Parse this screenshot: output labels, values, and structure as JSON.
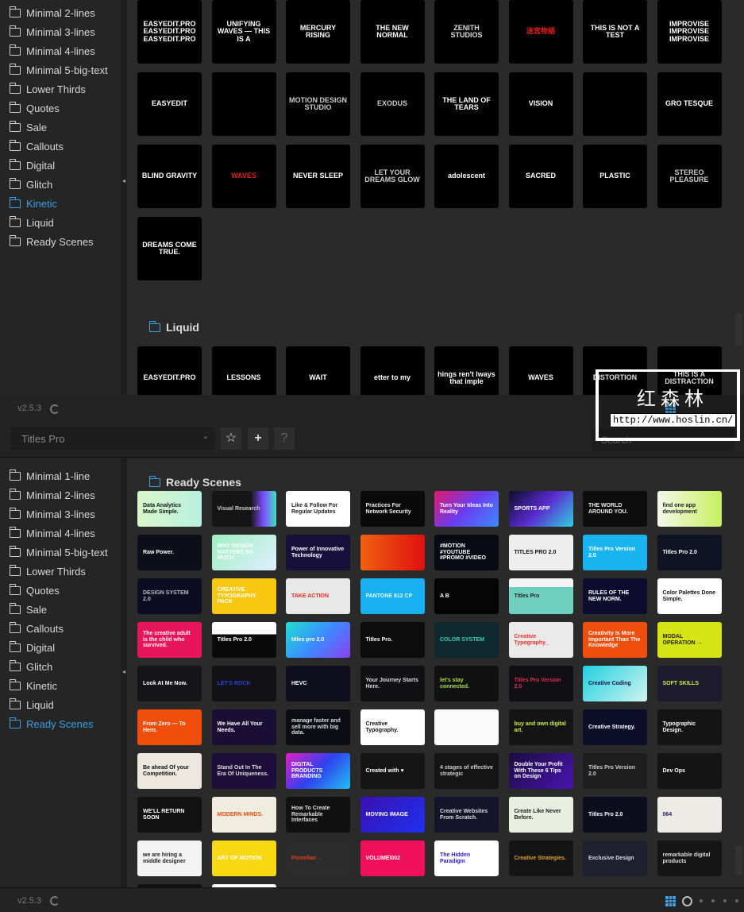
{
  "top_panel": {
    "sidebar": [
      {
        "label": "Minimal 2-lines"
      },
      {
        "label": "Minimal 3-lines"
      },
      {
        "label": "Minimal 4-lines"
      },
      {
        "label": "Minimal 5-big-text"
      },
      {
        "label": "Lower Thirds"
      },
      {
        "label": "Quotes"
      },
      {
        "label": "Sale"
      },
      {
        "label": "Callouts"
      },
      {
        "label": "Digital"
      },
      {
        "label": "Glitch"
      },
      {
        "label": "Kinetic",
        "active": true
      },
      {
        "label": "Liquid"
      },
      {
        "label": "Ready Scenes"
      }
    ],
    "kinetic_thumbs": [
      {
        "t": "EASYEDIT.PRO EASYEDIT.PRO EASYEDIT.PRO",
        "bg": "#000",
        "fg": "#fff"
      },
      {
        "t": "UNIFYING WAVES — THIS IS A",
        "bg": "#000",
        "fg": "#fff"
      },
      {
        "t": "MERCURY RISING",
        "bg": "#000",
        "fg": "#fff"
      },
      {
        "t": "THE NEW NORMAL",
        "bg": "#000",
        "fg": "#fff"
      },
      {
        "t": "ZENITH STUDIOS",
        "bg": "#000",
        "fg": "#ddd"
      },
      {
        "t": "迷宫物語",
        "bg": "#000",
        "fg": "#e0201c"
      },
      {
        "t": "THIS IS NOT A TEST",
        "bg": "#000",
        "fg": "#fff"
      },
      {
        "t": "IMPROVISE IMPROVISE IMPROVISE",
        "bg": "#000",
        "fg": "#fff"
      },
      {
        "t": "EASYEDIT",
        "bg": "#000",
        "fg": "#fff"
      },
      {
        "t": "",
        "bg": "#000",
        "fg": "#c00"
      },
      {
        "t": "MOTION DESIGN STUDIO",
        "bg": "#000",
        "fg": "#ccc"
      },
      {
        "t": "EXODUS",
        "bg": "#000",
        "fg": "#ccc"
      },
      {
        "t": "THE LAND OF TEARS",
        "bg": "#000",
        "fg": "#fff"
      },
      {
        "t": "VISION",
        "bg": "#000",
        "fg": "#fff"
      },
      {
        "t": "",
        "bg": "#000",
        "fg": "#e0201c"
      },
      {
        "t": "GRO TESQUE",
        "bg": "#000",
        "fg": "#fff"
      },
      {
        "t": "BLIND GRAVITY",
        "bg": "#000",
        "fg": "#fff"
      },
      {
        "t": "WAVES",
        "bg": "#000",
        "fg": "#e0201c"
      },
      {
        "t": "NEVER SLEEP",
        "bg": "#000",
        "fg": "#fff"
      },
      {
        "t": "LET YOUR DREAMS GLOW",
        "bg": "#000",
        "fg": "#ccc"
      },
      {
        "t": "adolescent",
        "bg": "#000",
        "fg": "#fff"
      },
      {
        "t": "SACRED",
        "bg": "#000",
        "fg": "#fff"
      },
      {
        "t": "PLASTIC",
        "bg": "#000",
        "fg": "#fff"
      },
      {
        "t": "STEREO PLEASURE",
        "bg": "#000",
        "fg": "#ccc"
      },
      {
        "t": "DREAMS COME TRUE.",
        "bg": "#000",
        "fg": "#fff"
      }
    ],
    "liquid_heading": "Liquid",
    "liquid_thumbs": [
      {
        "t": "EASYEDIT.PRO",
        "bg": "#000",
        "fg": "#fff"
      },
      {
        "t": "LESSONS",
        "bg": "#000",
        "fg": "#fff"
      },
      {
        "t": "WAIT",
        "bg": "#000",
        "fg": "#fff"
      },
      {
        "t": "etter to my",
        "bg": "#000",
        "fg": "#fff"
      },
      {
        "t": "hings ren't lways that imple",
        "bg": "#000",
        "fg": "#fff"
      },
      {
        "t": "WAVES",
        "bg": "#000",
        "fg": "#fff"
      },
      {
        "t": "DISTORTION",
        "bg": "#000",
        "fg": "#fff"
      },
      {
        "t": "THIS IS A DISTRACTION",
        "bg": "#000",
        "fg": "#fff"
      }
    ]
  },
  "footer_top": {
    "version": "v2.5.3"
  },
  "toolbar": {
    "preset": "Titles Pro",
    "star": "☆",
    "plus": "+",
    "help": "?",
    "search_placeholder": "Search"
  },
  "bottom_panel": {
    "sidebar": [
      {
        "label": "Minimal 1-line"
      },
      {
        "label": "Minimal 2-lines"
      },
      {
        "label": "Minimal 3-lines"
      },
      {
        "label": "Minimal 4-lines"
      },
      {
        "label": "Minimal 5-big-text"
      },
      {
        "label": "Lower Thirds"
      },
      {
        "label": "Quotes"
      },
      {
        "label": "Sale"
      },
      {
        "label": "Callouts"
      },
      {
        "label": "Digital"
      },
      {
        "label": "Glitch"
      },
      {
        "label": "Kinetic"
      },
      {
        "label": "Liquid"
      },
      {
        "label": "Ready Scenes",
        "active": true
      }
    ],
    "heading": "Ready Scenes",
    "thumbs": [
      {
        "t": "Data Analytics Made Simple.",
        "bg": "linear-gradient(90deg,#d9f7c8,#b8f0e0)",
        "fg": "#111"
      },
      {
        "t": "Visual Research",
        "bg": "linear-gradient(90deg,#151515 60%,#7a4cff,#46e0c0)",
        "fg": "#ccc"
      },
      {
        "t": "Like & Follow For Regular Updates",
        "bg": "#fff",
        "fg": "#222"
      },
      {
        "t": "Practices For Network Security",
        "bg": "#0a0a0a",
        "fg": "#eee"
      },
      {
        "t": "Turn Your Ideas Into Reality",
        "bg": "linear-gradient(135deg,#e4186b,#6a3cf0,#3b8cff)",
        "fg": "#fff"
      },
      {
        "t": "SPORTS APP",
        "bg": "linear-gradient(135deg,#0c0c2a,#5a2bd0,#30d0e0)",
        "fg": "#fff"
      },
      {
        "t": "THE WORLD AROUND YOU.",
        "bg": "#0d0d0d",
        "fg": "#eee"
      },
      {
        "t": "find one app development",
        "bg": "linear-gradient(90deg,#f4f8e8,#c8f060)",
        "fg": "#222"
      },
      {
        "t": "Raw Power.",
        "bg": "#0e0e1a",
        "fg": "#fff"
      },
      {
        "t": "WHY DESIGN MATTERS SO MUCH",
        "bg": "linear-gradient(135deg,#9ef0c0,#dfefff)",
        "fg": "#fff"
      },
      {
        "t": "Power of Innovative Technology",
        "bg": "#16103a",
        "fg": "#fff"
      },
      {
        "t": "",
        "bg": "linear-gradient(90deg,#f06010,#e01010)",
        "fg": "#fff"
      },
      {
        "t": "#MOTION #YOUTUBE #PROMO #VIDEO",
        "bg": "#0a0a14",
        "fg": "#fff"
      },
      {
        "t": "TITLES PRO 2.0",
        "bg": "#eeeeee",
        "fg": "#111"
      },
      {
        "t": "Titles Pro Version 2.0",
        "bg": "#18b4f0",
        "fg": "#fff"
      },
      {
        "t": "Titles Pro 2.0",
        "bg": "#0f1424",
        "fg": "#fff"
      },
      {
        "t": "DESIGN SYSTEM 2.0",
        "bg": "#0e0c22",
        "fg": "#bbb"
      },
      {
        "t": "CREATIVE TYPOGRAPHY PACK",
        "bg": "#f8c810",
        "fg": "#fff"
      },
      {
        "t": "TAKE ACTION",
        "bg": "#e8e8e8",
        "fg": "#e0301c"
      },
      {
        "t": "PANTONE 812 CP",
        "bg": "#18b0f0",
        "fg": "#dff"
      },
      {
        "t": "A B",
        "bg": "#050505",
        "fg": "#fff"
      },
      {
        "t": "Titles Pro",
        "bg": "linear-gradient(180deg,#f4f4f4 25%,#70d0c0 25%)",
        "fg": "#222"
      },
      {
        "t": "RULES OF THE NEW NORM.",
        "bg": "#0e0c2e",
        "fg": "#fff"
      },
      {
        "t": "Color Palettes Done Simple.",
        "bg": "#fff",
        "fg": "#111"
      },
      {
        "t": "The creative adult is the child who survived.",
        "bg": "#e8145c",
        "fg": "#fff"
      },
      {
        "t": "Titles Pro 2.0",
        "bg": "linear-gradient(180deg,#fff 35%,#0a0a0a 35%)",
        "fg": "#fff"
      },
      {
        "t": "titles pro 2.0",
        "bg": "linear-gradient(135deg,#20e0d0,#3a8cff,#8a40f0)",
        "fg": "#fff"
      },
      {
        "t": "Titles Pro.",
        "bg": "#0c0c0c",
        "fg": "#fff"
      },
      {
        "t": "COLOR SYSTEM",
        "bg": "#0f2a2e",
        "fg": "#3fd0b0"
      },
      {
        "t": "Creative Typography_",
        "bg": "#eaeaea",
        "fg": "#e8302c"
      },
      {
        "t": "Creativity Is More Important Than The Knowledge",
        "bg": "#f04e0c",
        "fg": "#fff"
      },
      {
        "t": "MODAL OPERATION →",
        "bg": "#d6e414",
        "fg": "#222"
      },
      {
        "t": "Look At Me Now.",
        "bg": "#151517",
        "fg": "#fff"
      },
      {
        "t": "LET'S ROCK",
        "bg": "#121214",
        "fg": "#3040e0"
      },
      {
        "t": "HEVC",
        "bg": "#0e0e1c",
        "fg": "#fff"
      },
      {
        "t": "Your Journey Starts Here.",
        "bg": "#111114",
        "fg": "#ddd"
      },
      {
        "t": "let's stay connected.",
        "bg": "#111",
        "fg": "#a8e040"
      },
      {
        "t": "Titles Pro Version 2.0",
        "bg": "#101014",
        "fg": "#e0304c"
      },
      {
        "t": "Creative Coding",
        "bg": "linear-gradient(135deg,#20d0e0,#d0f4f0)",
        "fg": "#114"
      },
      {
        "t": "SOFT SKILLS",
        "bg": "#1e1a30",
        "fg": "#c8f040"
      },
      {
        "t": "From Zero — To Hero.",
        "bg": "#f04e0a",
        "fg": "#fff"
      },
      {
        "t": "We Have All Your Needs.",
        "bg": "#1a0e34",
        "fg": "#fff"
      },
      {
        "t": "manage faster and sell more with big data.",
        "bg": "#0c0c14",
        "fg": "#ddd"
      },
      {
        "t": "Creative Typography.",
        "bg": "#fff",
        "fg": "#111"
      },
      {
        "t": "",
        "bg": "#fafafa",
        "fg": "#8030c0"
      },
      {
        "t": "buy and own digital art.",
        "bg": "#141414",
        "fg": "#c8f040"
      },
      {
        "t": "Creative Strategy.",
        "bg": "#0c0e2a",
        "fg": "#fff"
      },
      {
        "t": "Typographic Design.",
        "bg": "#141414",
        "fg": "#fff"
      },
      {
        "t": "Be ahead Of your Competition.",
        "bg": "#ece8e0",
        "fg": "#111"
      },
      {
        "t": "Stand Out In The Era Of Uniqueness.",
        "bg": "#1e0e3a",
        "fg": "#ddd"
      },
      {
        "t": "DIGITAL PRODUCTS BRANDING",
        "bg": "linear-gradient(135deg,#e020c0,#3040f0,#20c0f0)",
        "fg": "#fff"
      },
      {
        "t": "Created with ♥",
        "bg": "#151515",
        "fg": "#fff"
      },
      {
        "t": "4 stages of effective strategic",
        "bg": "#151515",
        "fg": "#ccc"
      },
      {
        "t": "Double Your Profit With These 6 Tips on Design",
        "bg": "linear-gradient(135deg,#1a0c40,#4a14b0)",
        "fg": "#fff"
      },
      {
        "t": "Titles Pro Version 2.0",
        "bg": "#1e1e1e",
        "fg": "#ccc"
      },
      {
        "t": "Dev Ops",
        "bg": "#141414",
        "fg": "#fff"
      },
      {
        "t": "WE'LL RETURN SOON",
        "bg": "#121212",
        "fg": "#fff"
      },
      {
        "t": "MODERN MINDS.",
        "bg": "#f0ece0",
        "fg": "#f04e0c"
      },
      {
        "t": "How To Create Remarkable Interfaces",
        "bg": "#111",
        "fg": "#ddd"
      },
      {
        "t": "MOVING IMAGE",
        "bg": "linear-gradient(135deg,#3a10b0,#2030f0)",
        "fg": "#fff"
      },
      {
        "t": "Creative Websites From Scratch.",
        "bg": "#14142a",
        "fg": "#ddd"
      },
      {
        "t": "Create Like Never Before.",
        "bg": "#eaeee0",
        "fg": "#222"
      },
      {
        "t": "Titles Pro 2.0",
        "bg": "#0c0e1e",
        "fg": "#fff"
      },
      {
        "t": "064",
        "bg": "#ecebe6",
        "fg": "#1e1e60"
      },
      {
        "t": "we are hiring a middle designer",
        "bg": "#f4f4f4",
        "fg": "#222"
      },
      {
        "t": "ART OF MOTION",
        "bg": "#f8d810",
        "fg": "#fff"
      },
      {
        "t": "Porzellan→",
        "bg": "#2c2c2c",
        "fg": "#e0401c"
      },
      {
        "t": "VOLUME\\002",
        "bg": "#f0105c",
        "fg": "#fff"
      },
      {
        "t": "The Hidden Paradigm",
        "bg": "#fff",
        "fg": "#3020d0"
      },
      {
        "t": "Creative Strategies.",
        "bg": "#141414",
        "fg": "#e0a030"
      },
      {
        "t": "Exclusive Design",
        "bg": "#1e2030",
        "fg": "#ddd"
      },
      {
        "t": "remarkable digital products",
        "bg": "#151515",
        "fg": "#ddd"
      },
      {
        "t": "",
        "bg": "#111",
        "fg": "#fff"
      },
      {
        "t": "",
        "bg": "#fff",
        "fg": "#111"
      }
    ]
  },
  "footer_bottom": {
    "version": "v2.5.3"
  },
  "watermark": {
    "cn": "红森林",
    "url": "http://www.hoslin.cn/"
  }
}
